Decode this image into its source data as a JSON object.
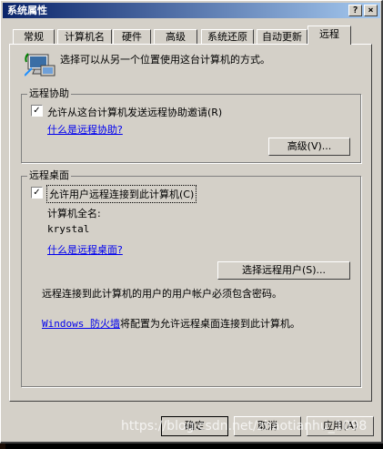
{
  "window": {
    "title": "系统属性",
    "help_button": "?",
    "close_button": "×"
  },
  "tabs": [
    {
      "label": "常规"
    },
    {
      "label": "计算机名"
    },
    {
      "label": "硬件"
    },
    {
      "label": "高级"
    },
    {
      "label": "系统还原"
    },
    {
      "label": "自动更新"
    },
    {
      "label": "远程",
      "active": true
    }
  ],
  "intro_text": "选择可以从另一个位置使用这台计算机的方式。",
  "remote_assistance": {
    "legend": "远程协助",
    "checkbox_label": "允许从这台计算机发送远程协助邀请(R)",
    "checked": true,
    "help_link": "什么是远程协助?",
    "advanced_button": "高级(V)..."
  },
  "remote_desktop": {
    "legend": "远程桌面",
    "checkbox_label": "允许用户远程连接到此计算机(C)",
    "checked": true,
    "full_name_label": "计算机全名:",
    "computer_name": "krystal",
    "help_link": "什么是远程桌面?",
    "select_users_button": "选择远程用户(S)...",
    "password_note": "远程连接到此计算机的用户的用户帐户必须包含密码。",
    "firewall_link": "Windows 防火墙",
    "firewall_text": "将配置为允许远程桌面连接到此计算机。"
  },
  "footer": {
    "ok": "确定",
    "cancel": "取消",
    "apply": "应用(A)"
  },
  "watermark": "https://blog.csdn.net/zhaotianhu_1098",
  "colors": {
    "face": "#d4d0c8",
    "title_start": "#0a246a",
    "title_end": "#a6caf0",
    "link": "#0000ee"
  }
}
